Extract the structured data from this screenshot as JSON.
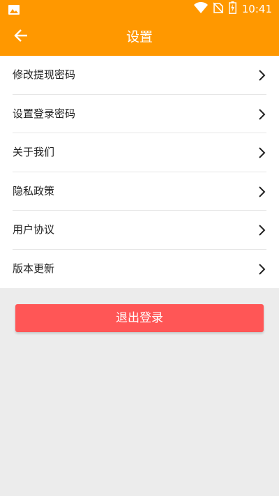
{
  "status_bar": {
    "time": "10:41",
    "icons": [
      "image-icon",
      "wifi-icon",
      "no-sim-icon",
      "battery-charging-icon"
    ]
  },
  "toolbar": {
    "title": "设置",
    "back_icon": "arrow-left-icon"
  },
  "menu": {
    "items": [
      {
        "label": "修改提现密码",
        "icon": "chevron-right-icon"
      },
      {
        "label": "设置登录密码",
        "icon": "chevron-right-icon"
      },
      {
        "label": "关于我们",
        "icon": "chevron-right-icon"
      },
      {
        "label": "隐私政策",
        "icon": "chevron-right-icon"
      },
      {
        "label": "用户协议",
        "icon": "chevron-right-icon"
      },
      {
        "label": "版本更新",
        "icon": "chevron-right-icon"
      }
    ]
  },
  "logout": {
    "label": "退出登录"
  },
  "colors": {
    "header": "#ff9800",
    "logout_button": "#ff5656",
    "page_background": "#ececec"
  }
}
